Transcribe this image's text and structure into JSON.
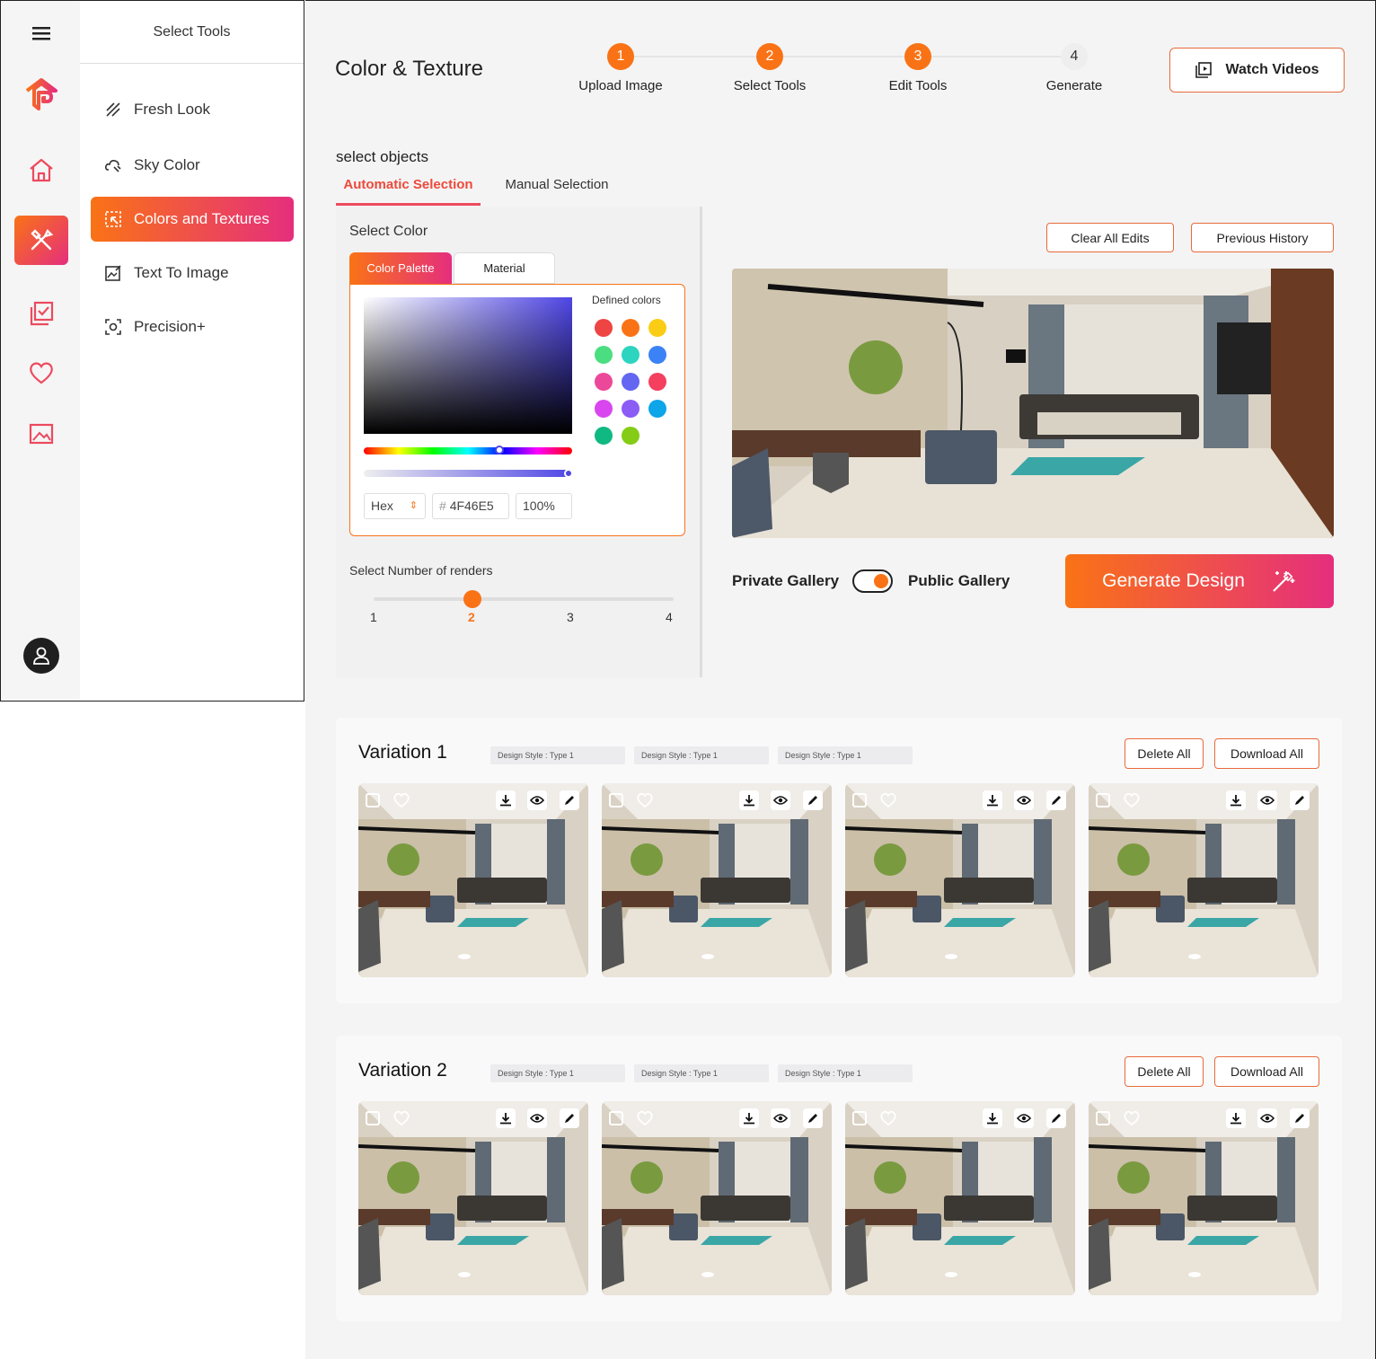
{
  "tools_panel": {
    "title": "Select Tools",
    "items": [
      {
        "label": "Fresh Look",
        "icon": "pencil-lines-icon"
      },
      {
        "label": "Sky Color",
        "icon": "cloud-paint-icon"
      },
      {
        "label": "Colors and Textures",
        "icon": "selection-icon"
      },
      {
        "label": "Text To Image",
        "icon": "image-edit-icon"
      },
      {
        "label": "Precision+",
        "icon": "focus-icon"
      }
    ]
  },
  "header": {
    "title": "Color & Texture",
    "steps": [
      {
        "number": "1",
        "label": "Upload Image"
      },
      {
        "number": "2",
        "label": "Select Tools"
      },
      {
        "number": "3",
        "label": "Edit Tools"
      },
      {
        "number": "4",
        "label": "Generate"
      }
    ],
    "watch_videos": "Watch Videos"
  },
  "selection": {
    "heading": "select objects",
    "tabs": [
      "Automatic Selection",
      "Manual Selection"
    ],
    "select_color": "Select Color",
    "color_tabs": [
      "Color Palette",
      "Material"
    ],
    "defined_colors_label": "Defined colors",
    "defined_colors": [
      "#ef4444",
      "#f97316",
      "#facc15",
      "#4ade80",
      "#2dd4bf",
      "#3b82f6",
      "#ec4899",
      "#6366f1",
      "#f43f5e",
      "#d946ef",
      "#8b5cf6",
      "#0ea5e9",
      "#10b981",
      "#84cc16"
    ],
    "format": "Hex",
    "hash": "#",
    "hex_value": "4F46E5",
    "opacity": "100%",
    "renders_label": "Select Number of renders",
    "render_options": [
      "1",
      "2",
      "3",
      "4"
    ],
    "selected_renders": "2"
  },
  "preview": {
    "clear_edits": "Clear All Edits",
    "previous_history": "Previous History",
    "private_gallery": "Private Gallery",
    "public_gallery": "Public Gallery",
    "generate": "Generate Design"
  },
  "variations": [
    {
      "title": "Variation 1",
      "tags": [
        "Design Style :  Type 1",
        "Design Style :  Type 1",
        "Design Style :  Type 1"
      ],
      "delete_all": "Delete All",
      "download_all": "Download All"
    },
    {
      "title": "Variation 2",
      "tags": [
        "Design Style :  Type 1",
        "Design Style :  Type 1",
        "Design Style :  Type 1"
      ],
      "delete_all": "Delete All",
      "download_all": "Download All"
    }
  ],
  "colors": {
    "accent": "#f97316",
    "accent_pink": "#e52e7d"
  }
}
